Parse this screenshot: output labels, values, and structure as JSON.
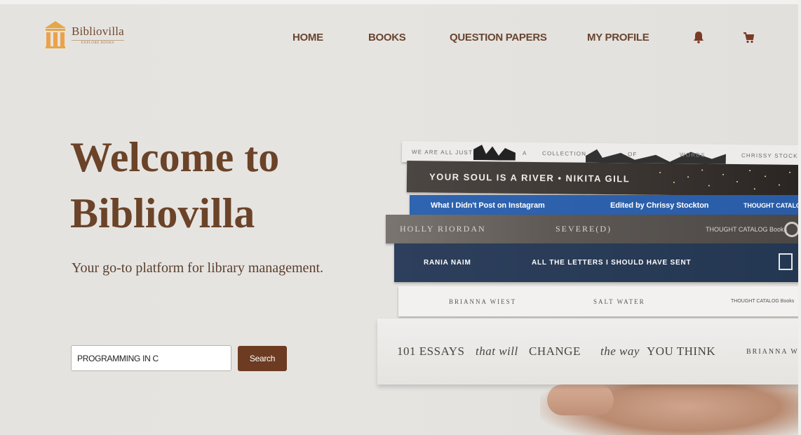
{
  "brand": {
    "name": "Bibliovilla",
    "tagline": "EXPLORE BOOKS"
  },
  "nav": {
    "items": [
      {
        "label": "HOME"
      },
      {
        "label": "BOOKS"
      },
      {
        "label": "QUESTION PAPERS"
      },
      {
        "label": "MY PROFILE"
      }
    ],
    "icons": [
      "bell-icon",
      "cart-icon"
    ]
  },
  "hero": {
    "title_line1": "Welcome to",
    "title_line2": "Bibliovilla",
    "subtitle": "Your go-to platform for library management."
  },
  "search": {
    "value": "PROGRAMMING IN C",
    "button_label": "Search"
  },
  "books": {
    "b1": {
      "left": "WE ARE ALL JUST",
      "mid1": "A",
      "mid2": "COLLECTION",
      "mid3": "OF",
      "mid4": "WORDS",
      "right": "CHRISSY STOCKT"
    },
    "b2": {
      "title": "YOUR SOUL IS A RIVER  •  NIKITA GILL"
    },
    "b3": {
      "title": "What I Didn't Post on Instagram",
      "author": "Edited by Chrissy Stockton",
      "publisher": "THOUGHT CATALOG Boo"
    },
    "b4": {
      "author": "HOLLY RIORDAN",
      "title": "SEVERE(D)",
      "publisher": "THOUGHT CATALOG Books"
    },
    "b5": {
      "author": "RANIA NAIM",
      "title": "ALL THE LETTERS I SHOULD HAVE SENT"
    },
    "b6": {
      "author": "BRIANNA WIEST",
      "title": "SALT WATER",
      "publisher": "THOUGHT CATALOG Books"
    },
    "b7": {
      "title_a": "101 ESSAYS",
      "title_b": "that will",
      "title_c": "CHANGE",
      "title_d": "the way",
      "title_e": "YOU THINK",
      "author": "BRIANNA WI"
    }
  },
  "colors": {
    "accent": "#6c3b22",
    "heading": "#6b4328",
    "nav": "#6a4530"
  }
}
